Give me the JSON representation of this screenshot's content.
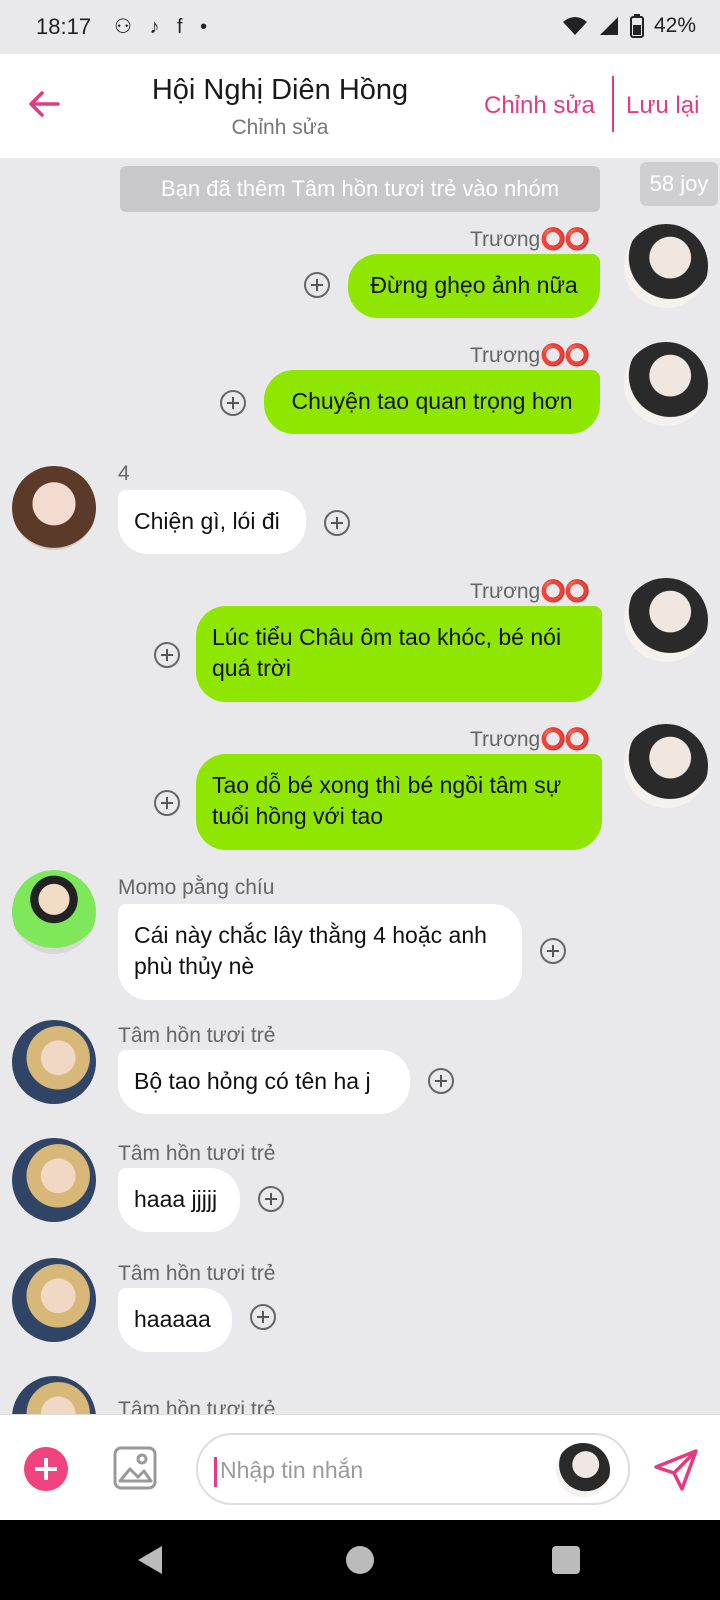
{
  "status_bar": {
    "time": "18:17",
    "notif_icons": "⚇ ♪ f •",
    "battery": "42%"
  },
  "header": {
    "title": "Hội Nghị Diên Hồng",
    "subtitle": "Chỉnh sửa",
    "edit_label": "Chỉnh sửa",
    "save_label": "Lưu lại",
    "accent": "#e33b83"
  },
  "system_message": "Bạn đã thêm Tâm hồn tươi trẻ vào nhóm",
  "joy_badge": "58 joy",
  "messages": [
    {
      "sender": "Trương",
      "sender_suffix": "⭕⭕",
      "text": "Đừng ghẹo ảnh nữa",
      "outgoing": true
    },
    {
      "sender": "Trương",
      "sender_suffix": "⭕⭕",
      "text": "Chuyện tao quan trọng hơn",
      "outgoing": true
    },
    {
      "sender": "4",
      "text": "Chiện gì, lói đi",
      "outgoing": false
    },
    {
      "sender": "Trương",
      "sender_suffix": "⭕⭕",
      "text": "Lúc tiểu Châu ôm tao khóc, bé nói quá trời",
      "outgoing": true
    },
    {
      "sender": "Trương",
      "sender_suffix": "⭕⭕",
      "text": "Tao dỗ bé xong thì bé ngồi tâm sự tuổi hồng với tao",
      "outgoing": true
    },
    {
      "sender": "Momo pằng chíu",
      "text": "Cái này chắc lây thằng 4 hoặc anh phù thủy nè",
      "outgoing": false
    },
    {
      "sender": "Tâm hồn tươi trẻ",
      "text": "Bộ tao hỏng có tên ha j",
      "outgoing": false
    },
    {
      "sender": "Tâm hồn tươi trẻ",
      "text": "haaa jjjjj",
      "outgoing": false
    },
    {
      "sender": "Tâm hồn tươi trẻ",
      "text": "haaaaa",
      "outgoing": false
    },
    {
      "sender": "Tâm hồn tươi trẻ",
      "outgoing": false
    }
  ],
  "composer": {
    "placeholder": "Nhập tin nhắn"
  },
  "colors": {
    "outgoing_bubble": "#8fe600",
    "incoming_bubble": "#ffffff",
    "background": "#e9e9ec"
  }
}
